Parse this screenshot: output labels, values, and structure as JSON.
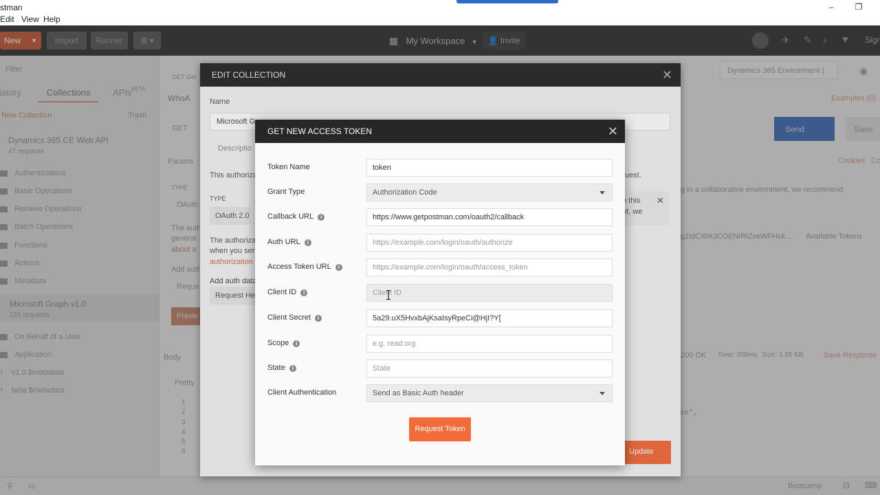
{
  "window": {
    "app_title": "stman",
    "minimize": "‒",
    "restore": "❐"
  },
  "menu": [
    "Edit",
    "View",
    "Help"
  ],
  "header": {
    "new_label": "New",
    "import_label": "Import",
    "runner_label": "Runner",
    "workspace_label": "My Workspace",
    "invite_label": "Invite",
    "sign_label": "Sign"
  },
  "sidebar": {
    "filter_placeholder": "Filter",
    "tabs": [
      "istory",
      "Collections",
      "APIs"
    ],
    "apis_badge": "BETA",
    "new_collection": "New Collection",
    "trash": "Trash",
    "collection1": {
      "name": "Dynamics 365 CE Web API",
      "count": "47 requests"
    },
    "folders1": [
      "Authentications",
      "Basic Operations",
      "Retrieve Operations",
      "Batch Operations",
      "Functions",
      "Actions",
      "Metadata"
    ],
    "collection2": {
      "name": "Microsoft Graph v1.0",
      "count": "125 requests"
    },
    "folders2": [
      "On Behalf of a User",
      "Application"
    ],
    "requests": [
      {
        "method": "T",
        "name": "v1.0 $metadata"
      },
      {
        "method": "T",
        "name": "beta $metadata"
      }
    ]
  },
  "main": {
    "tab_label": "GET Get",
    "breadcrumb": "WhoA",
    "method": "GET",
    "params": "Params",
    "type_label": "TYPE",
    "oauth": "OAuth",
    "the_auth": "The auth",
    "generate": "generat",
    "about": "about a",
    "add_auth": "Add auth",
    "request": "Reque",
    "preview": "Previe",
    "body": "Body",
    "pretty": "Pretty",
    "line_numbers": [
      "1",
      "2",
      "3",
      "4",
      "5",
      "6"
    ],
    "env_select": "Dynamics 365 Environment (",
    "examples": "Examples (0)",
    "send": "Send",
    "save": "Save",
    "cookies": "Cookies",
    "co": "Co",
    "collab_notice": "g in a collaborative environment, we recommend",
    "token_value": "g1tdCI6IkJCOENIRlZxeWFHck...",
    "available_tokens": "Available Tokens",
    "kens": "kens",
    "status": "200 OK",
    "time": "Time: 350ms",
    "size": "Size: 1.55 KB",
    "save_response": "Save Response",
    "code_tail": "nse\","
  },
  "edit_collection": {
    "title": "EDIT COLLECTION",
    "name_label": "Name",
    "name_value": "Microsoft G",
    "description_tab": "Descriptio",
    "auth_text": "This authoriza",
    "request_suffix": "uest.",
    "type_label": "TYPE",
    "type_value": "OAuth 2.0",
    "authorization_p1": "The authoriza",
    "authorization_p2": "when you sen",
    "authorization_link": "authorization",
    "add_auth_data": "Add auth data",
    "request_header": "Request Hea",
    "p_this": "p this",
    "nt_we": "nt, we",
    "update": "Update"
  },
  "token_modal": {
    "title": "GET NEW ACCESS TOKEN",
    "fields": {
      "token_name": {
        "label": "Token Name",
        "value": "token"
      },
      "grant_type": {
        "label": "Grant Type",
        "value": "Authorization Code"
      },
      "callback_url": {
        "label": "Callback URL",
        "value": "https://www.getpostman.com/oauth2/callback"
      },
      "auth_url": {
        "label": "Auth URL",
        "placeholder": "https://example.com/login/oauth/authorize"
      },
      "access_token_url": {
        "label": "Access Token URL",
        "placeholder": "https://example.com/login/oauth/access_token"
      },
      "client_id": {
        "label": "Client ID",
        "placeholder": "Client ID"
      },
      "client_secret": {
        "label": "Client Secret",
        "value": "5a29.uX5HvxbAjKsaIsyRpeCi@HjI?Y["
      },
      "scope": {
        "label": "Scope",
        "placeholder": "e.g. read:org"
      },
      "state": {
        "label": "State",
        "placeholder": "State"
      },
      "client_auth": {
        "label": "Client Authentication",
        "value": "Send as Basic Auth header"
      }
    },
    "request_token": "Request Token"
  },
  "statusbar": {
    "bootcamp": "Bootcamp"
  },
  "colors": {
    "accent": "#f26b3a",
    "header_dark": "#262626",
    "send_blue": "#2d6bc4"
  }
}
